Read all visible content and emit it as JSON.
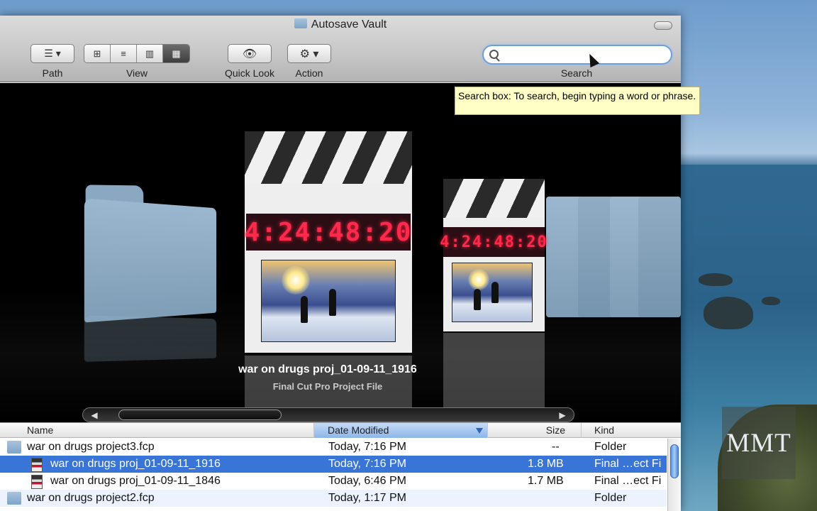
{
  "window": {
    "title": "Autosave Vault"
  },
  "toolbar": {
    "path_label": "Path",
    "view_label": "View",
    "quicklook_label": "Quick Look",
    "action_label": "Action",
    "search_label": "Search",
    "search_value": "",
    "view_modes": [
      "icon-view",
      "list-view",
      "column-view",
      "coverflow-view"
    ],
    "active_view": "coverflow-view"
  },
  "tooltip": {
    "text": "Search box: To search, begin typing a word or phrase."
  },
  "coverflow": {
    "timecode": "4:24:48:20",
    "selected_name": "war on drugs proj_01-09-11_1916",
    "selected_kind": "Final Cut Pro Project File"
  },
  "list": {
    "columns": {
      "name": "Name",
      "date": "Date Modified",
      "size": "Size",
      "kind": "Kind"
    },
    "sort_column": "date",
    "rows": [
      {
        "name": "war on drugs project3.fcp",
        "date": "Today, 7:16 PM",
        "size": "--",
        "kind": "Folder",
        "icon": "folder-icon"
      },
      {
        "name": "war on drugs proj_01-09-11_1916",
        "date": "Today, 7:16 PM",
        "size": "1.8 MB",
        "kind": "Final …ect Fi",
        "icon": "fcp-file-icon"
      },
      {
        "name": "war on drugs proj_01-09-11_1846",
        "date": "Today, 6:46 PM",
        "size": "1.7 MB",
        "kind": "Final …ect Fi",
        "icon": "fcp-file-icon"
      },
      {
        "name": "war on drugs project2.fcp",
        "date": "Today, 1:17 PM",
        "size": "",
        "kind": "Folder",
        "icon": "folder-icon"
      }
    ],
    "selected_row": 1
  },
  "watermark": {
    "text": "MMT"
  },
  "colors": {
    "selection": "#3875d7",
    "tooltip_bg": "#ffffc6",
    "lcd_red": "#ff2a4b"
  }
}
